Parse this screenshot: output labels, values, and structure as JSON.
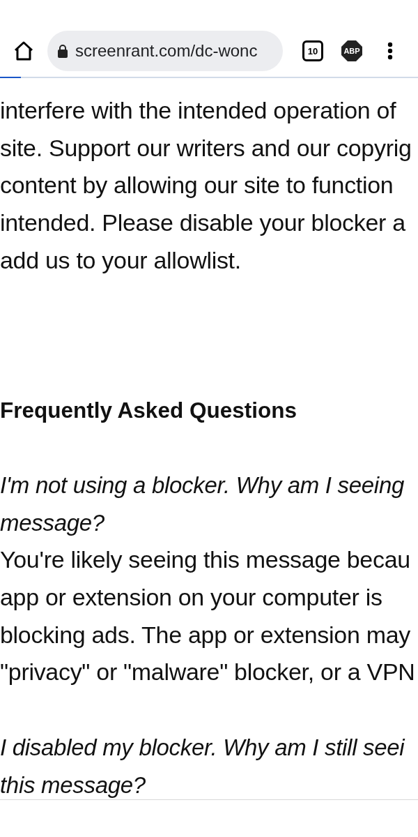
{
  "toolbar": {
    "url": "screenrant.com/dc-wonc",
    "tab_count": "10",
    "extension_badge": "ABP"
  },
  "page_load": {
    "level": 0.05
  },
  "article": {
    "paragraph_lines": [
      "interfere with the intended operation of",
      "site. Support our writers and our copyrig",
      "content by allowing our site to function",
      "intended. Please disable your blocker a",
      "add us to your allowlist."
    ],
    "heading": "Frequently Asked Questions",
    "faq": [
      {
        "question_lines": [
          "I'm not using a blocker. Why am I seeing",
          "message?"
        ],
        "answer_lines": [
          "You're likely seeing this message becau",
          "app or extension on your computer is",
          "blocking ads. The app or extension may",
          "\"privacy\" or \"malware\" blocker, or a VPN"
        ]
      },
      {
        "question_lines": [
          "I disabled my blocker. Why am I still seei",
          "this message?"
        ]
      }
    ]
  }
}
